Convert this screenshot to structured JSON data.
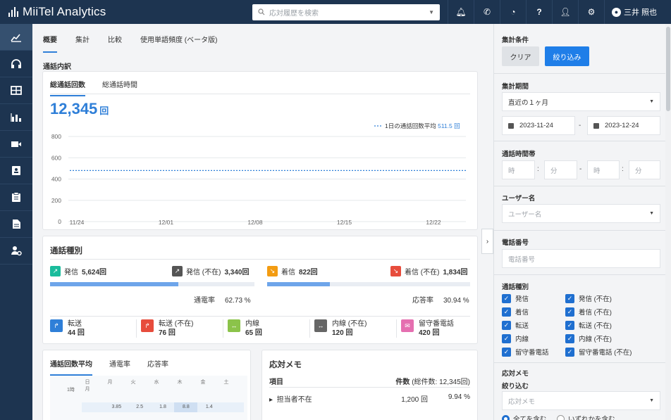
{
  "header": {
    "brand": "MiiTel Analytics",
    "search_placeholder": "応対履歴を検索",
    "user_name": "三井 照也",
    "icons": [
      "bell-icon",
      "phone-icon",
      "dashboard-icon",
      "help-icon",
      "user-admin-icon",
      "gear-icon"
    ]
  },
  "sidebar": {
    "items": [
      "analytics-icon",
      "headset-icon",
      "table-icon",
      "bar-chart-icon",
      "video-icon",
      "contact-book-icon",
      "clipboard-icon",
      "document-icon",
      "user-settings-icon"
    ]
  },
  "tabs": [
    "概要",
    "集計",
    "比較",
    "使用単語頻度 (ベータ版)"
  ],
  "main": {
    "section_title": "通話内訳",
    "call_tabs": [
      "総通話回数",
      "総通話時間"
    ],
    "total_count": "12,345",
    "total_unit": "回",
    "legend_label": "1日の通話回数平均",
    "legend_value": "511.5 回"
  },
  "chart_data": {
    "type": "line",
    "x": [
      "11/24",
      "12/01",
      "12/08",
      "12/15",
      "12/22"
    ],
    "yticks": [
      0,
      200,
      400,
      600,
      800
    ],
    "ylim": [
      0,
      800
    ],
    "series": [
      {
        "name": "1日の通話回数平均",
        "values": [
          480,
          480,
          480,
          480,
          480
        ],
        "style": "dotted",
        "color": "#2f7fd8"
      }
    ],
    "grid": true
  },
  "call_types": {
    "title": "通話種別",
    "stats": [
      {
        "label": "発信",
        "value": "5,624回",
        "color": "#1abc9c",
        "icon": "outgoing-icon"
      },
      {
        "label": "発信 (不在)",
        "value": "3,340回",
        "color": "#555555",
        "icon": "outgoing-missed-icon"
      },
      {
        "label": "着信",
        "value": "822回",
        "color": "#f39c12",
        "icon": "incoming-icon"
      },
      {
        "label": "着信 (不在)",
        "value": "1,834回",
        "color": "#e74c3c",
        "icon": "incoming-missed-icon"
      }
    ],
    "connect_rate_label": "通電率",
    "connect_rate_value": "62.73 %",
    "connect_rate_fraction": 0.6273,
    "answer_rate_label": "応答率",
    "answer_rate_value": "30.94 %",
    "answer_rate_fraction": 0.3094,
    "minis": [
      {
        "label": "転送",
        "value": "44 回",
        "color": "#2f7fd8",
        "icon": "transfer-icon"
      },
      {
        "label": "転送 (不在)",
        "value": "76 回",
        "color": "#e74c3c",
        "icon": "transfer-missed-icon"
      },
      {
        "label": "内線",
        "value": "65 回",
        "color": "#8bc34a",
        "icon": "extension-icon"
      },
      {
        "label": "内線 (不在)",
        "value": "120 回",
        "color": "#666666",
        "icon": "extension-missed-icon"
      },
      {
        "label": "留守番電話",
        "value": "420 回",
        "color": "#e56fb0",
        "icon": "voicemail-icon"
      }
    ]
  },
  "avg_panel": {
    "tabs": [
      "通話回数平均",
      "通電率",
      "応答率"
    ],
    "days": [
      "日\n月",
      "月",
      "火",
      "水",
      "木",
      "金",
      "土"
    ],
    "hour_label": "1時",
    "values": [
      "",
      "3.85",
      "2.5",
      "1.8",
      "8.8",
      "1.4",
      ""
    ]
  },
  "memo": {
    "title": "応対メモ",
    "col_item": "項目",
    "col_count": "件数",
    "col_total": "(総件数: 12,345回)",
    "rows": [
      {
        "label": "担当者不在",
        "count": "1,200 回",
        "pct": "9.94 %"
      }
    ]
  },
  "filters": {
    "title": "集計条件",
    "clear_label": "クリア",
    "apply_label": "絞り込み",
    "period_label": "集計期間",
    "period_value": "直近の１ヶ月",
    "date_from": "2023-11-24",
    "date_to": "2023-12-24",
    "time_label": "通話時間帯",
    "time_ph": [
      "時",
      "分",
      "時",
      "分"
    ],
    "user_label": "ユーザー名",
    "user_ph": "ユーザー名",
    "phone_label": "電話番号",
    "phone_ph": "電話番号",
    "type_label": "通話種別",
    "types_left": [
      "発信",
      "着信",
      "転送",
      "内線",
      "留守番電話"
    ],
    "types_right": [
      "発信 (不在)",
      "着信 (不在)",
      "転送 (不在)",
      "内線 (不在)",
      "留守番電話 (不在)"
    ],
    "memo_label": "応対メモ",
    "narrow_label": "絞り込む",
    "memo_ph": "応対メモ",
    "radio_all": "全てを含む",
    "radio_any": "いずれかを含む"
  }
}
